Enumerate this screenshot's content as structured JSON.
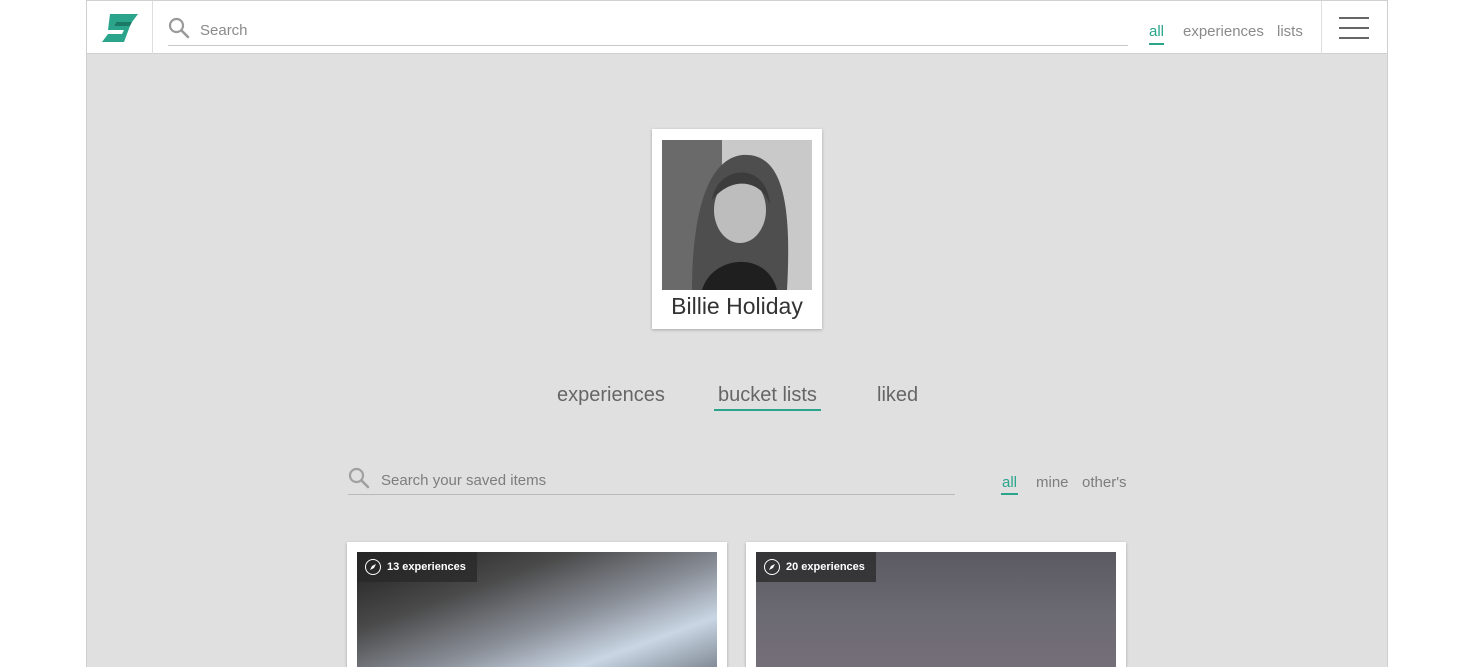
{
  "header": {
    "logo_alt": "S",
    "search_placeholder": "Search",
    "filters": [
      "all",
      "experiences",
      "lists"
    ],
    "active_filter": "all",
    "accent_color": "#2aa58b"
  },
  "profile": {
    "name": "Billie Holiday"
  },
  "profile_tabs": {
    "items": [
      "experiences",
      "bucket lists",
      "liked"
    ],
    "active": "bucket lists"
  },
  "saved_search": {
    "placeholder": "Search your saved items",
    "filters": [
      "all",
      "mine",
      "other's"
    ],
    "active": "all"
  },
  "lists": [
    {
      "count_label": "13 experiences"
    },
    {
      "count_label": "20 experiences"
    }
  ]
}
